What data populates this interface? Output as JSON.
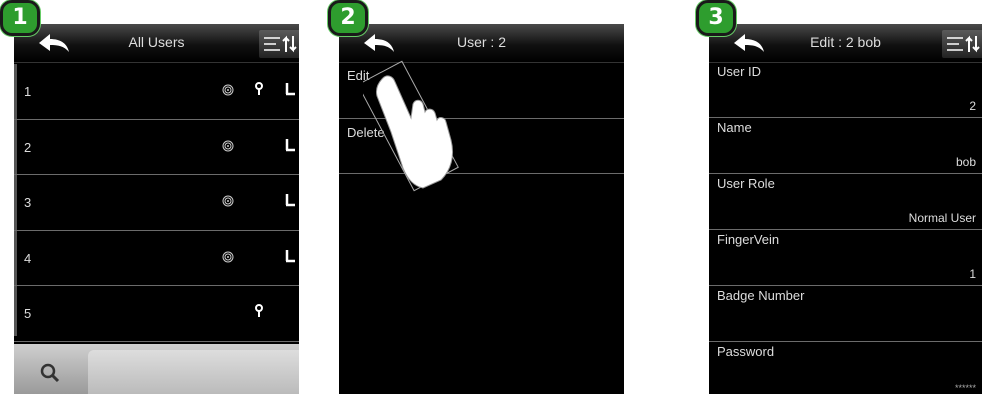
{
  "badges": [
    "1",
    "2",
    "3"
  ],
  "panel1": {
    "title": "All Users",
    "users": [
      {
        "num": "1",
        "fingerprint": true,
        "key": true,
        "face": true
      },
      {
        "num": "2",
        "fingerprint": true,
        "key": false,
        "face": true
      },
      {
        "num": "3",
        "fingerprint": true,
        "key": false,
        "face": true
      },
      {
        "num": "4",
        "fingerprint": true,
        "key": false,
        "face": true
      },
      {
        "num": "5",
        "fingerprint": false,
        "key": true,
        "face": false
      }
    ],
    "search_icon": "search-icon"
  },
  "panel2": {
    "title": "User : 2",
    "menu": [
      "Edit",
      "Delete"
    ]
  },
  "panel3": {
    "title": "Edit : 2 bob",
    "fields": [
      {
        "label": "User ID",
        "value": "2"
      },
      {
        "label": "Name",
        "value": "bob"
      },
      {
        "label": "User Role",
        "value": "Normal User"
      },
      {
        "label": "FingerVein",
        "value": "1"
      },
      {
        "label": "Badge Number",
        "value": ""
      },
      {
        "label": "Password",
        "value": "******"
      }
    ]
  }
}
